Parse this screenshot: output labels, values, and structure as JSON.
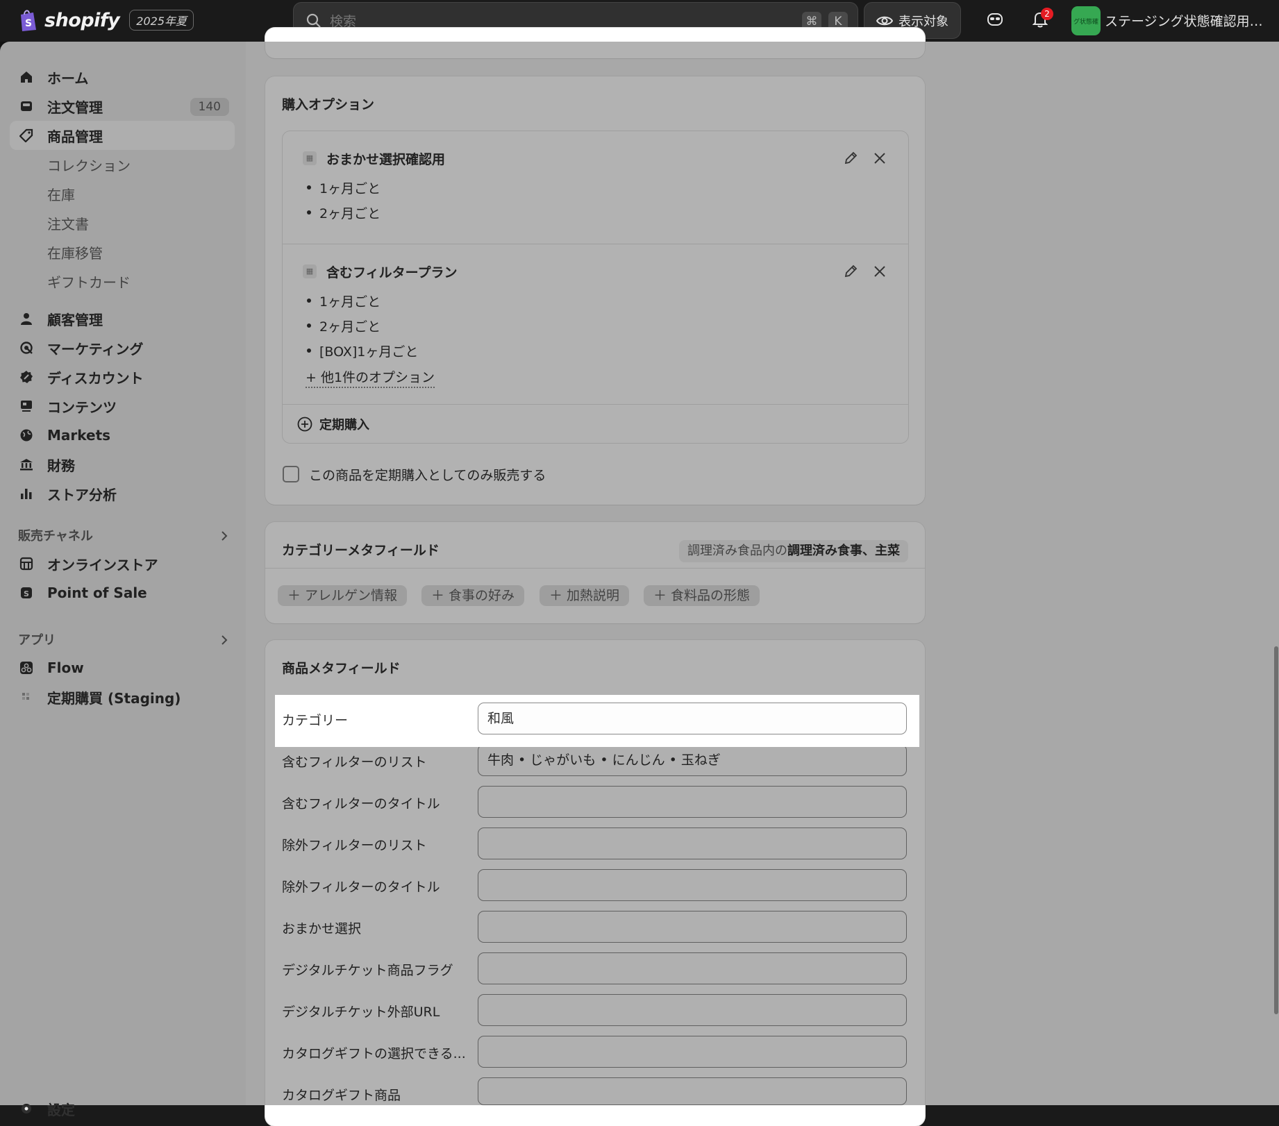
{
  "topbar": {
    "brand": "shopify",
    "edition": "2025年夏",
    "search_placeholder": "検索",
    "kbd_cmd": "⌘",
    "kbd_k": "K",
    "view_label": "表示対象",
    "notif_count": "2",
    "store_avatar_text": "グ状態確",
    "store_name": "ステージング状態確認用ス..."
  },
  "sidebar": {
    "items": [
      {
        "label": "ホーム"
      },
      {
        "label": "注文管理",
        "count": "140"
      },
      {
        "label": "商品管理"
      },
      {
        "label": "コレクション"
      },
      {
        "label": "在庫"
      },
      {
        "label": "注文書"
      },
      {
        "label": "在庫移管"
      },
      {
        "label": "ギフトカード"
      },
      {
        "label": "顧客管理"
      },
      {
        "label": "マーケティング"
      },
      {
        "label": "ディスカウント"
      },
      {
        "label": "コンテンツ"
      },
      {
        "label": "Markets"
      },
      {
        "label": "財務"
      },
      {
        "label": "ストア分析"
      }
    ],
    "sales_channels_header": "販売チャネル",
    "channels": [
      {
        "label": "オンラインストア"
      },
      {
        "label": "Point of Sale"
      }
    ],
    "apps_header": "アプリ",
    "apps": [
      {
        "label": "Flow"
      },
      {
        "label": "定期購買 (Staging)"
      }
    ],
    "settings_label": "設定"
  },
  "purchase_options": {
    "title": "購入オプション",
    "plans": [
      {
        "name": "おまかせ選択確認用",
        "frequencies": [
          "1ヶ月ごと",
          "2ヶ月ごと"
        ]
      },
      {
        "name": "含むフィルタープラン",
        "frequencies": [
          "1ヶ月ごと",
          "2ヶ月ごと",
          "[BOX]1ヶ月ごと"
        ],
        "more": "+ 他1件のオプション"
      }
    ],
    "add_label": "定期購入",
    "checkbox_label": "この商品を定期購入としてのみ販売する"
  },
  "category_metafields": {
    "title": "カテゴリーメタフィールド",
    "category_prefix": "調理済み食品内の",
    "category_bold": "調理済み食事、主菜",
    "chips": [
      "＋ アレルゲン情報",
      "＋ 食事の好み",
      "＋ 加熱説明",
      "＋ 食料品の形態"
    ]
  },
  "product_metafields": {
    "title": "商品メタフィールド",
    "fields": [
      {
        "label": "カテゴリー",
        "value": "和風"
      },
      {
        "label": "含むフィルターのリスト",
        "value": "牛肉 • じゃがいも • にんじん • 玉ねぎ"
      },
      {
        "label": "含むフィルターのタイトル",
        "value": ""
      },
      {
        "label": "除外フィルターのリスト",
        "value": ""
      },
      {
        "label": "除外フィルターのタイトル",
        "value": ""
      },
      {
        "label": "おまかせ選択",
        "value": ""
      },
      {
        "label": "デジタルチケット商品フラグ",
        "value": ""
      },
      {
        "label": "デジタルチケット外部URL",
        "value": ""
      },
      {
        "label": "カタログギフトの選択できる...",
        "value": ""
      },
      {
        "label": "カタログギフト商品",
        "value": ""
      }
    ]
  },
  "colors": {
    "accent_green": "#36a852",
    "notif_red": "#e51c23",
    "topbar_bg": "#1a1a1a"
  }
}
